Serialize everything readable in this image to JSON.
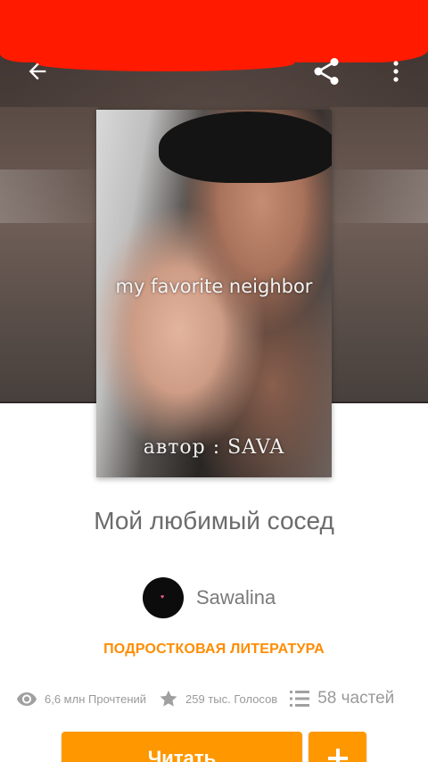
{
  "colors": {
    "accent": "#ff9800",
    "category": "#ff8c00",
    "status_bar": "#ff1a00",
    "text_muted": "#9a9a9a",
    "title_text": "#6b6b6b"
  },
  "toolbar": {
    "back_icon": "arrow-left-icon",
    "share_icon": "share-icon",
    "more_icon": "more-vertical-icon"
  },
  "cover": {
    "title": "my favorite neighbor",
    "author": "автор : SAVA"
  },
  "story": {
    "title": "Мой любимый сосед",
    "author_name": "Sawalina",
    "category": "ПОДРОСТКОВАЯ ЛИТЕРАТУРА"
  },
  "stats": {
    "reads": "6,6 млн Прочтений",
    "votes": "259 тыс. Голосов",
    "parts": "58 частей",
    "reads_icon": "eye-icon",
    "votes_icon": "star-icon",
    "parts_icon": "list-icon"
  },
  "actions": {
    "read_label": "Читать",
    "add_icon": "plus-icon"
  }
}
